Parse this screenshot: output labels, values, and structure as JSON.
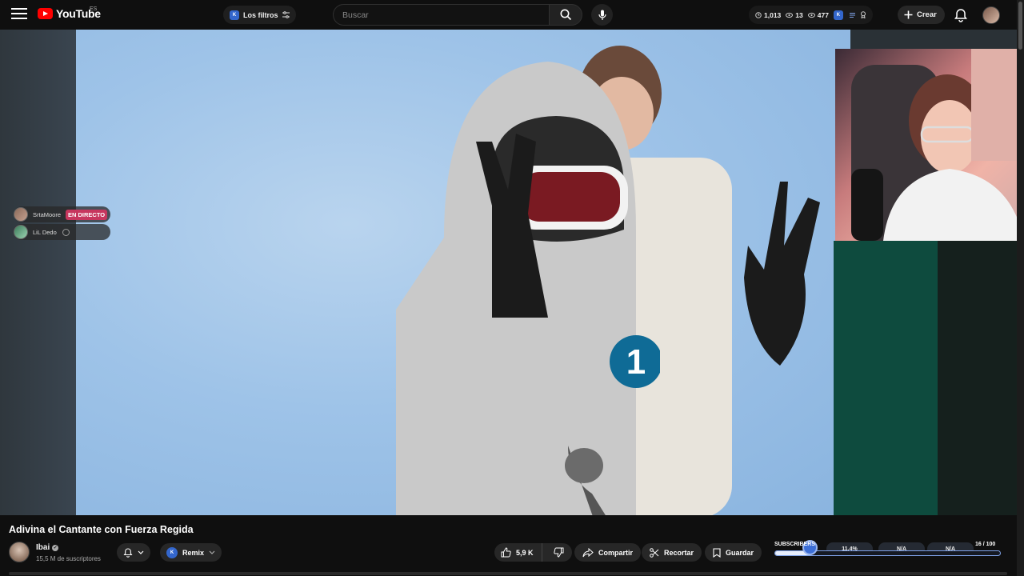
{
  "header": {
    "logo_text": "YouTube",
    "region": "ES",
    "filters_label": "Los filtros",
    "search_placeholder": "Buscar",
    "stats": {
      "views": "1,013",
      "watching": "13",
      "eyes": "477"
    },
    "create_label": "Crear"
  },
  "live_list": [
    {
      "name": "SrtaMoore",
      "badge": "EN DIRECTO"
    },
    {
      "name": "LiL Dedo"
    }
  ],
  "video": {
    "title": "Adivina el Cantante con Fuerza Regida",
    "channel": "Ibai",
    "subscribers": "15,5 M de suscriptores"
  },
  "actions": {
    "remix": "Remix",
    "likes": "5,9 K",
    "share": "Compartir",
    "clip": "Recortar",
    "save": "Guardar"
  },
  "extension": {
    "label": "SUBSCRIBERS",
    "stat1": "11.4%",
    "stat2": "N/A",
    "stat3": "N/A",
    "goal_current": "16",
    "goal_total": "100",
    "goal_progress": 0.16
  },
  "colors": {
    "accent": "#ff0000",
    "live_badge": "#c7375e",
    "ext_blue": "#3c6ed6"
  }
}
